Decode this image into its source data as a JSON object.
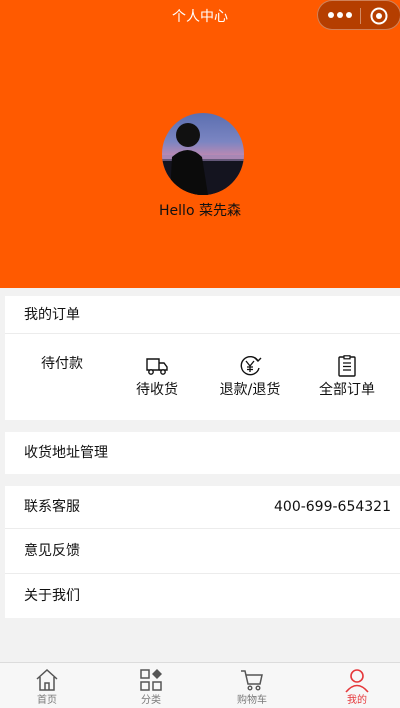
{
  "nav": {
    "title": "个人中心"
  },
  "profile": {
    "greeting": "Hello 菜先森"
  },
  "orders": {
    "title": "我的订单",
    "items": [
      {
        "label": "待付款",
        "icon": "wallet-icon"
      },
      {
        "label": "待收货",
        "icon": "truck-icon"
      },
      {
        "label": "退款/退货",
        "icon": "yen-refund-icon"
      },
      {
        "label": "全部订单",
        "icon": "clipboard-icon"
      }
    ]
  },
  "address": {
    "label": "收货地址管理"
  },
  "service": {
    "contact_label": "联系客服",
    "phone": "400-699-654321",
    "feedback_label": "意见反馈",
    "about_label": "关于我们"
  },
  "tabbar": {
    "items": [
      {
        "label": "首页",
        "icon": "home-icon"
      },
      {
        "label": "分类",
        "icon": "category-icon"
      },
      {
        "label": "购物车",
        "icon": "cart-icon"
      },
      {
        "label": "我的",
        "icon": "user-icon"
      }
    ],
    "active_color": "#e5383b"
  },
  "colors": {
    "header": "#ff5a00"
  }
}
